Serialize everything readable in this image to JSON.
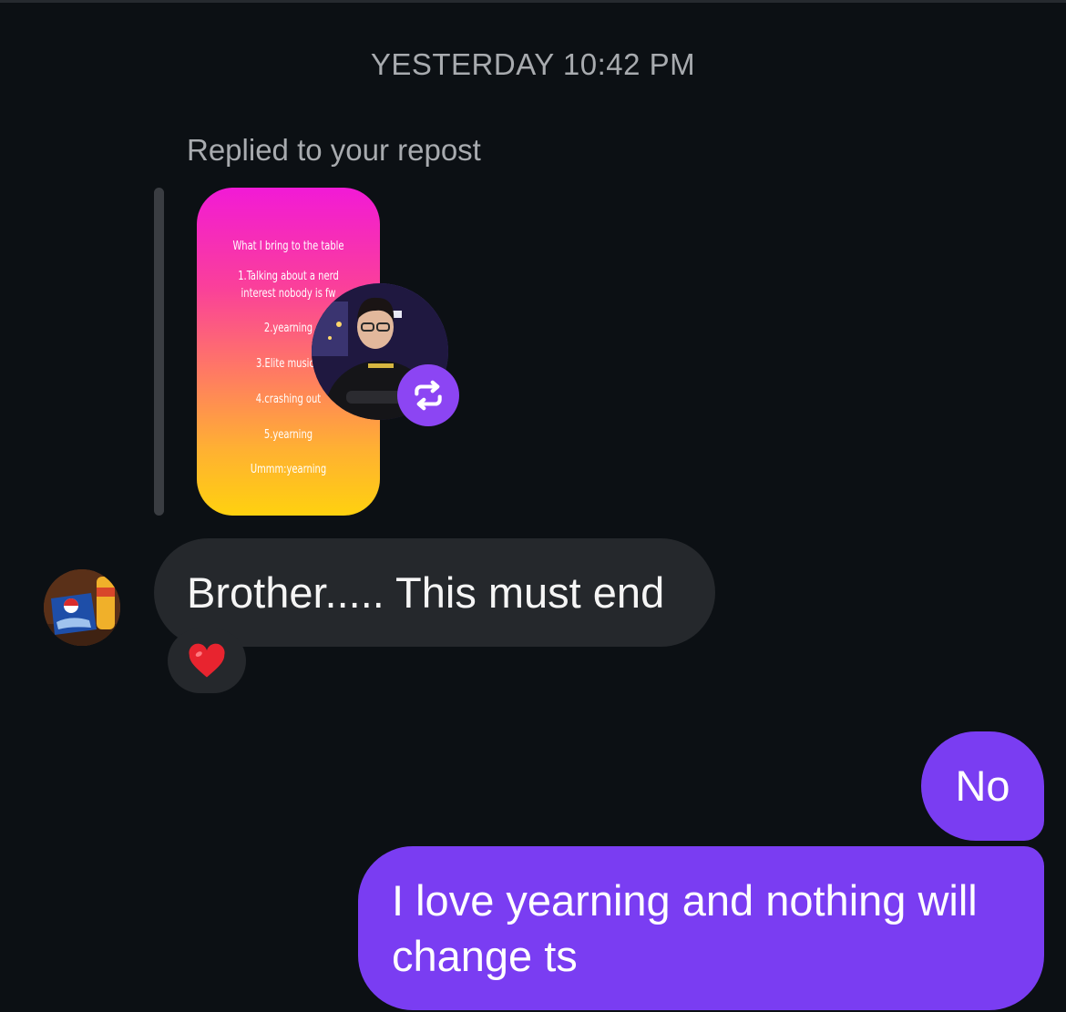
{
  "thread": {
    "timestamp": "YESTERDAY 10:42 PM",
    "reply_context": "Replied to your repost"
  },
  "story": {
    "lines": [
      "What I bring to the table",
      "1.Talking about a nerd",
      "interest nobody is fw",
      "2.yearning",
      "3.Elite music t",
      "4.crashing out",
      "5.yearning",
      "Ummm:yearning"
    ],
    "gradient": [
      "#f21ad6",
      "#ffd10f"
    ],
    "badge_icon": "repost-icon",
    "badge_color": "#8c45f3"
  },
  "messages": {
    "incoming": {
      "text": "Brother..... This must end",
      "reaction": "❤️"
    },
    "outgoing": [
      {
        "text": "No"
      },
      {
        "text": "I love yearning and nothing will change ts"
      }
    ]
  },
  "colors": {
    "background": "#0c1014",
    "incoming_bubble": "#25282c",
    "outgoing_bubble": "#7a3df2"
  }
}
